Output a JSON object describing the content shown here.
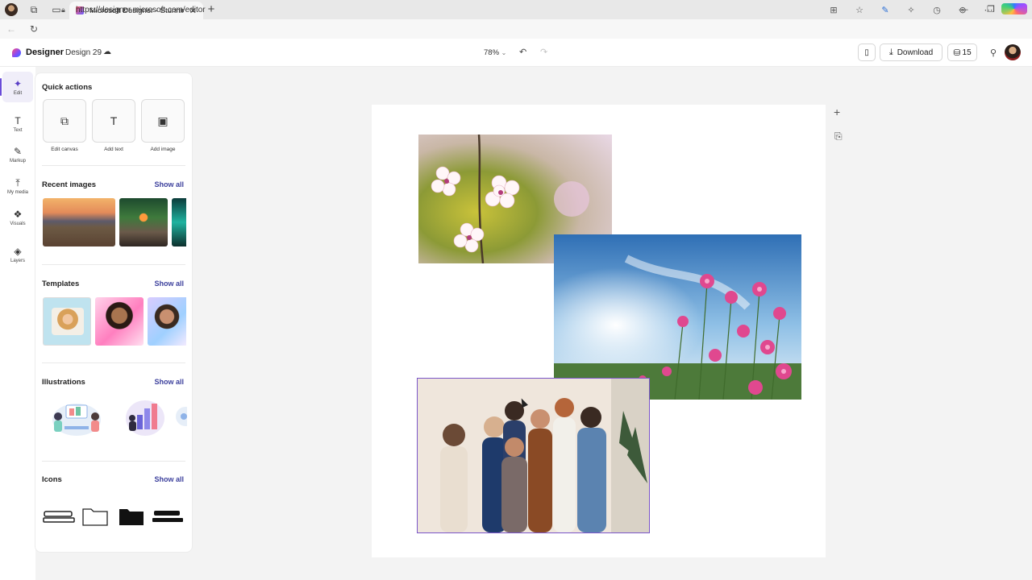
{
  "browser": {
    "tab_title": "Microsoft Designer - Stunning de",
    "tab_close": "✕",
    "new_tab": "+",
    "url": "https://designer.microsoft.com/editor",
    "window_controls": [
      "—",
      "❐",
      "✕"
    ]
  },
  "header": {
    "brand": "Designer",
    "design_name": "Design 29",
    "zoom": "78%",
    "download_label": "Download",
    "credits": "15"
  },
  "rail": [
    {
      "label": "Edit",
      "icon": "✦",
      "active": true
    },
    {
      "label": "Text",
      "icon": "T",
      "active": false
    },
    {
      "label": "Markup",
      "icon": "✎",
      "active": false
    },
    {
      "label": "My media",
      "icon": "⤒",
      "active": false
    },
    {
      "label": "Visuals",
      "icon": "❖",
      "active": false
    },
    {
      "label": "Layers",
      "icon": "◈",
      "active": false
    }
  ],
  "panel": {
    "quick_actions_title": "Quick actions",
    "quick_actions": [
      {
        "label": "Edit canvas",
        "icon": "⧉"
      },
      {
        "label": "Add text",
        "icon": "T"
      },
      {
        "label": "Add image",
        "icon": "▣"
      }
    ],
    "recent_images_title": "Recent images",
    "templates_title": "Templates",
    "illustrations_title": "Illustrations",
    "icons_title": "Icons",
    "show_all": "Show all"
  },
  "colors": {
    "accent": "#6a4cd8",
    "link": "#3b3f9c",
    "selection": "#7a55c8"
  }
}
